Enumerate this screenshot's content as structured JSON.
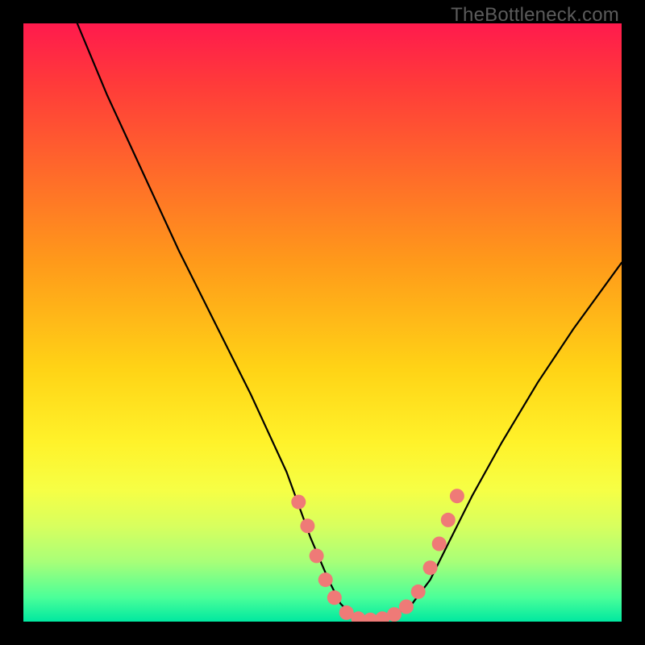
{
  "watermark": "TheBottleneck.com",
  "chart_data": {
    "type": "line",
    "title": "",
    "xlabel": "",
    "ylabel": "",
    "xlim": [
      0,
      100
    ],
    "ylim": [
      0,
      100
    ],
    "series": [
      {
        "name": "bottleneck-curve",
        "x": [
          9,
          14,
          20,
          26,
          32,
          38,
          44,
          48,
          51,
          53,
          55,
          57,
          59,
          62,
          65,
          68,
          71,
          75,
          80,
          86,
          92,
          100
        ],
        "y": [
          100,
          88,
          75,
          62,
          50,
          38,
          25,
          14,
          7,
          3,
          1,
          0,
          0,
          1,
          3,
          7,
          13,
          21,
          30,
          40,
          49,
          60
        ]
      }
    ],
    "markers": {
      "name": "highlight-dots",
      "color": "#ef7a77",
      "points": [
        {
          "x": 46,
          "y": 20
        },
        {
          "x": 47.5,
          "y": 16
        },
        {
          "x": 49,
          "y": 11
        },
        {
          "x": 50.5,
          "y": 7
        },
        {
          "x": 52,
          "y": 4
        },
        {
          "x": 54,
          "y": 1.5
        },
        {
          "x": 56,
          "y": 0.5
        },
        {
          "x": 58,
          "y": 0.3
        },
        {
          "x": 60,
          "y": 0.5
        },
        {
          "x": 62,
          "y": 1.2
        },
        {
          "x": 64,
          "y": 2.5
        },
        {
          "x": 66,
          "y": 5
        },
        {
          "x": 68,
          "y": 9
        },
        {
          "x": 69.5,
          "y": 13
        },
        {
          "x": 71,
          "y": 17
        },
        {
          "x": 72.5,
          "y": 21
        }
      ]
    },
    "gradient_stops": [
      {
        "pos": 0,
        "color": "#ff1a4d"
      },
      {
        "pos": 10,
        "color": "#ff3a3a"
      },
      {
        "pos": 25,
        "color": "#ff6a2a"
      },
      {
        "pos": 40,
        "color": "#ff9a1a"
      },
      {
        "pos": 58,
        "color": "#ffd416"
      },
      {
        "pos": 70,
        "color": "#fff22a"
      },
      {
        "pos": 78,
        "color": "#f6ff45"
      },
      {
        "pos": 84,
        "color": "#d8ff5e"
      },
      {
        "pos": 90,
        "color": "#a8ff78"
      },
      {
        "pos": 96,
        "color": "#4aff99"
      },
      {
        "pos": 100,
        "color": "#00e8a0"
      }
    ]
  }
}
